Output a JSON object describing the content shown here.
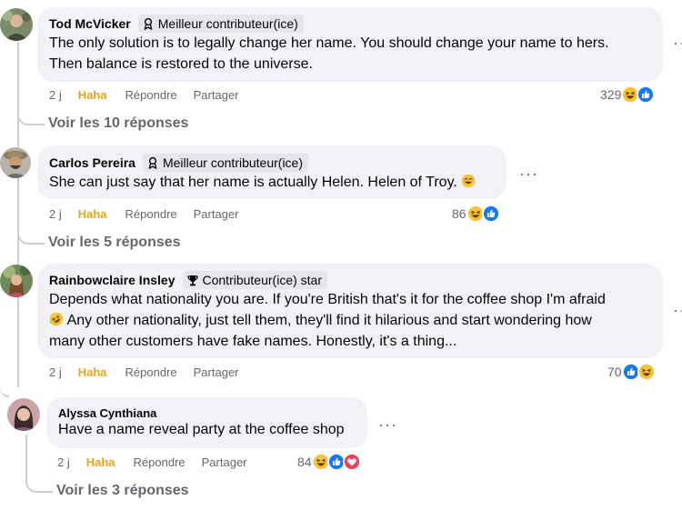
{
  "ui": {
    "haha_color": "#e6a417",
    "meta_color": "#65676b",
    "bubble_color": "#f0f2f5",
    "badge_color": "#e4e6eb"
  },
  "comments": [
    {
      "author": "Tod McVicker",
      "badge": "Meilleur contributeur(ice)",
      "badge_icon": "top-contributor-icon",
      "text_lines": [
        "The only solution is to legally change her name. You should change your name to hers.",
        "Then balance is restored to the universe."
      ],
      "time": "2 j",
      "reaction_label": "Haha",
      "reply_label": "Répondre",
      "share_label": "Partager",
      "reaction_count": "329",
      "reaction_icons": [
        "haha-icon",
        "like-icon"
      ],
      "more_label": "···",
      "view_replies": "Voir les 10 réponses"
    },
    {
      "author": "Carlos Pereira",
      "badge": "Meilleur contributeur(ice)",
      "badge_icon": "top-contributor-icon",
      "text_lines": [
        "She can just say that her name is actually Helen. Helen of Troy."
      ],
      "text_emoji": "grinning-sweat-emoji",
      "time": "2 j",
      "reaction_label": "Haha",
      "reply_label": "Répondre",
      "share_label": "Partager",
      "reaction_count": "86",
      "reaction_icons": [
        "haha-icon",
        "like-icon"
      ],
      "more_label": "···",
      "view_replies": "Voir les 5 réponses"
    },
    {
      "author": "Rainbowclaire Insley",
      "badge": "Contributeur(ice) star",
      "badge_icon": "trophy-icon",
      "text_lines": [
        "Depends what nationality you are. If you're British that's it for the coffee shop I'm afraid",
        "Any other nationality, just tell them, they'll find it hilarious and start wondering how",
        "many other customers have fake names. Honestly, it's a thing..."
      ],
      "text_emoji": "rofl-emoji",
      "time": "2 j",
      "reaction_label": "Haha",
      "reply_label": "Répondre",
      "share_label": "Partager",
      "reaction_count": "70",
      "reaction_icons": [
        "like-icon",
        "haha-icon"
      ],
      "more_label": "···"
    },
    {
      "author": "Alyssa Cynthiana",
      "text_lines": [
        "Have a name reveal party at the coffee shop"
      ],
      "time": "2 j",
      "reaction_label": "Haha",
      "reply_label": "Répondre",
      "share_label": "Partager",
      "reaction_count": "84",
      "reaction_icons": [
        "haha-icon",
        "like-icon",
        "love-icon"
      ],
      "more_label": "···",
      "view_replies": "Voir les 3 réponses"
    }
  ]
}
